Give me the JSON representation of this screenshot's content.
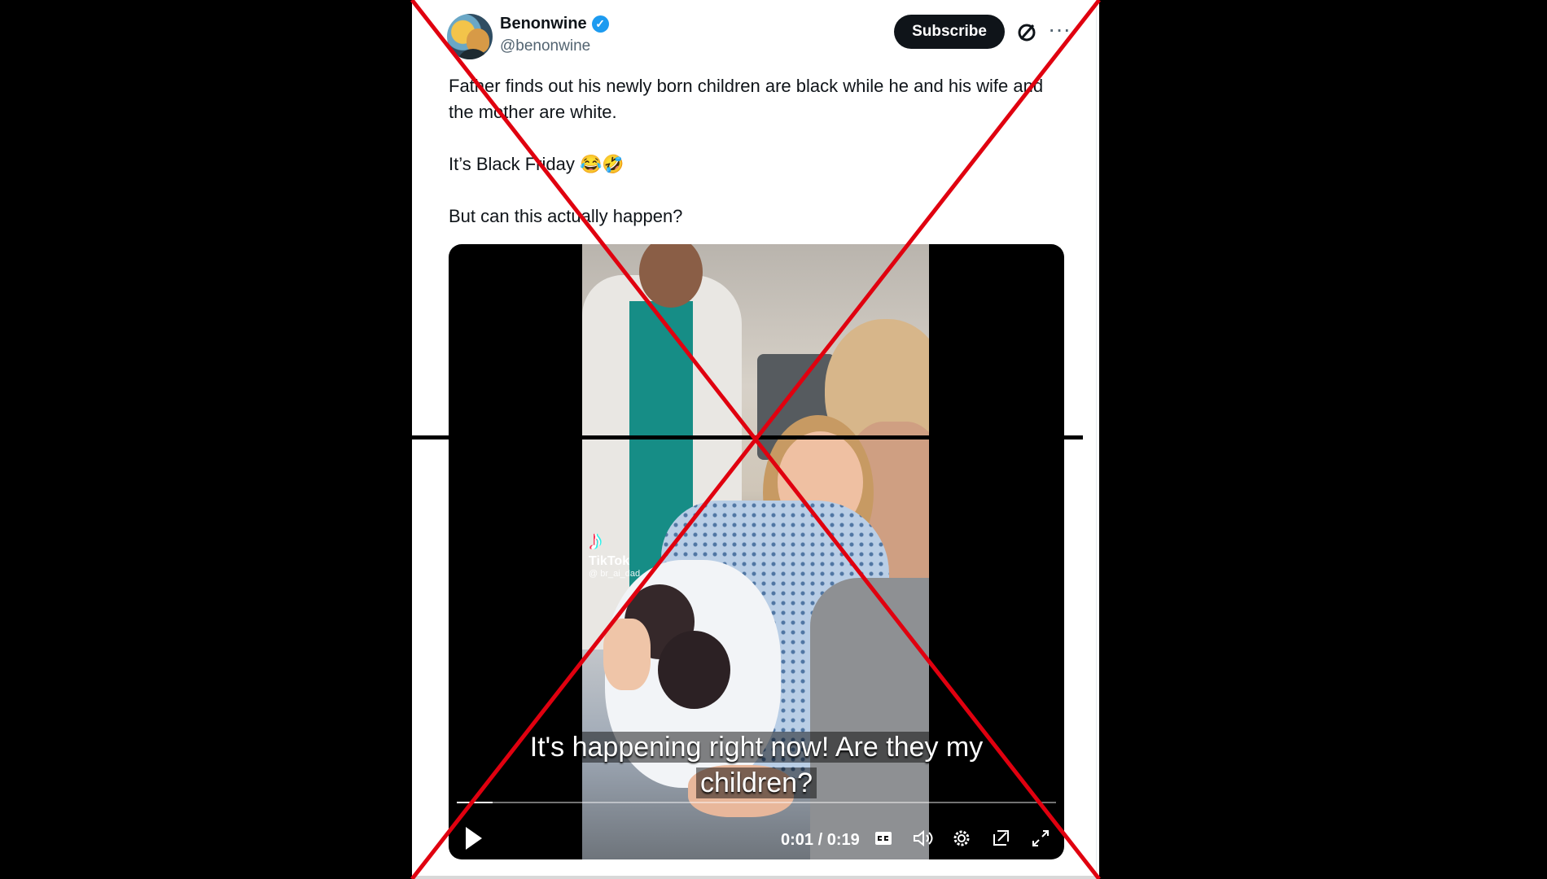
{
  "author": {
    "name": "Benonwine",
    "handle": "@benonwine",
    "verified_label": "✓"
  },
  "actions": {
    "subscribe_label": "Subscribe",
    "more_label": "···"
  },
  "tweet": {
    "paragraphs": [
      "Father finds out his newly born children are black while he and his wife and the mother are white.",
      "It’s Black Friday 😂🤣",
      "But can this actually happen?"
    ]
  },
  "video": {
    "watermark_brand": "TikTok",
    "watermark_user": "@ br_ai_dad",
    "caption_line1": "It's happening right now! Are they my",
    "caption_line2": "children?",
    "time": "0:01 / 0:19",
    "progress": 0.06
  },
  "colors": {
    "background": "#000000",
    "card": "#ffffff",
    "accent": "#1d9bf0",
    "strike": "#e0000f"
  },
  "icons": {
    "verified": "verified-badge-icon",
    "grok": "grok-icon",
    "more": "more-icon",
    "play": "play-icon",
    "captions": "captions-icon",
    "volume": "volume-icon",
    "settings": "settings-icon",
    "pip": "picture-in-picture-icon",
    "fullscreen": "fullscreen-icon"
  }
}
